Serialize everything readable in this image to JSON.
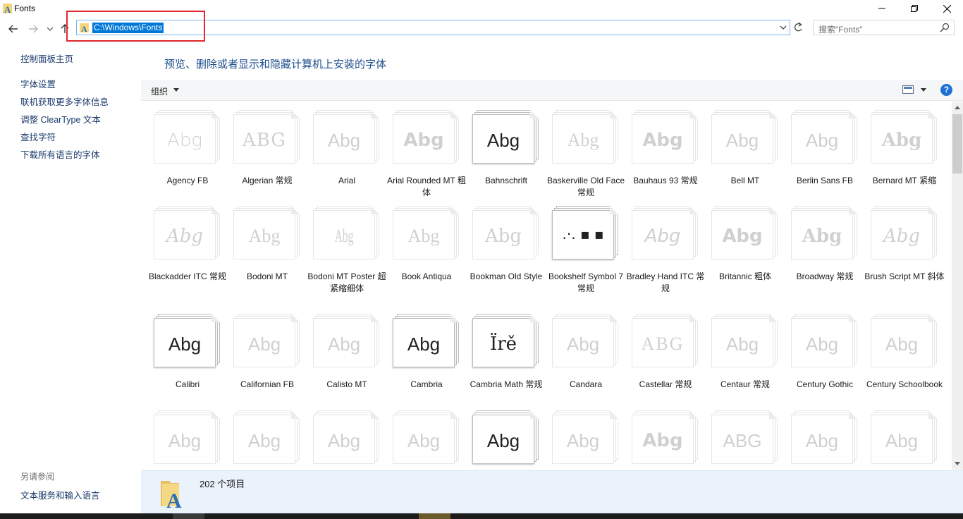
{
  "window": {
    "title": "Fonts"
  },
  "address": {
    "path": "C:\\Windows\\Fonts"
  },
  "search": {
    "placeholder": "搜索\"Fonts\""
  },
  "left_pane": {
    "home": "控制面板主页",
    "links": [
      "字体设置",
      "联机获取更多字体信息",
      "调整 ClearType 文本",
      "查找字符",
      "下载所有语言的字体"
    ],
    "see_also_title": "另请参阅",
    "see_also": [
      "文本服务和输入语言"
    ]
  },
  "heading": "预览、删除或者显示和隐藏计算机上安装的字体",
  "toolbar": {
    "organize": "组织",
    "help": "?"
  },
  "fonts": [
    {
      "name": "Agency FB",
      "sample": "Abg",
      "selected": false
    },
    {
      "name": "Algerian 常规",
      "sample": "ABG",
      "selected": false
    },
    {
      "name": "Arial",
      "sample": "Abg",
      "selected": false
    },
    {
      "name": "Arial Rounded MT 粗体",
      "sample": "Abg",
      "selected": false
    },
    {
      "name": "Bahnschrift",
      "sample": "Abg",
      "selected": true
    },
    {
      "name": "Baskerville Old Face 常规",
      "sample": "Abg",
      "selected": false
    },
    {
      "name": "Bauhaus 93 常规",
      "sample": "Abg",
      "selected": false
    },
    {
      "name": "Bell MT",
      "sample": "Abg",
      "selected": false
    },
    {
      "name": "Berlin Sans FB",
      "sample": "Abg",
      "selected": false
    },
    {
      "name": "Bernard MT 紧缩",
      "sample": "Abg",
      "selected": false
    },
    {
      "name": "Blackadder ITC 常规",
      "sample": "Abg",
      "selected": false
    },
    {
      "name": "Bodoni MT",
      "sample": "Abg",
      "selected": false
    },
    {
      "name": "Bodoni MT Poster 超紧缩细体",
      "sample": "Abg",
      "selected": false
    },
    {
      "name": "Book Antiqua",
      "sample": "Abg",
      "selected": false
    },
    {
      "name": "Bookman Old Style",
      "sample": "Abg",
      "selected": false
    },
    {
      "name": "Bookshelf Symbol 7 常规",
      "sample": ".·. ▪ ▪",
      "selected": true
    },
    {
      "name": "Bradley Hand ITC 常规",
      "sample": "Abg",
      "selected": false
    },
    {
      "name": "Britannic 粗体",
      "sample": "Abg",
      "selected": false
    },
    {
      "name": "Broadway 常规",
      "sample": "Abg",
      "selected": false
    },
    {
      "name": "Brush Script MT 斜体",
      "sample": "Abg",
      "selected": false
    },
    {
      "name": "Calibri",
      "sample": "Abg",
      "selected": true
    },
    {
      "name": "Californian FB",
      "sample": "Abg",
      "selected": false
    },
    {
      "name": "Calisto MT",
      "sample": "Abg",
      "selected": false
    },
    {
      "name": "Cambria",
      "sample": "Abg",
      "selected": true
    },
    {
      "name": "Cambria Math 常规",
      "sample": "Ïrě",
      "selected": true
    },
    {
      "name": "Candara",
      "sample": "Abg",
      "selected": false
    },
    {
      "name": "Castellar 常规",
      "sample": "ABG",
      "selected": false
    },
    {
      "name": "Centaur 常规",
      "sample": "Abg",
      "selected": false
    },
    {
      "name": "Century Gothic",
      "sample": "Abg",
      "selected": false
    },
    {
      "name": "Century Schoolbook",
      "sample": "Abg",
      "selected": false
    },
    {
      "name": "",
      "sample": "Abg",
      "selected": false
    },
    {
      "name": "",
      "sample": "Abg",
      "selected": false
    },
    {
      "name": "",
      "sample": "Abg",
      "selected": false
    },
    {
      "name": "",
      "sample": "Abg",
      "selected": false
    },
    {
      "name": "",
      "sample": "Abg",
      "selected": true
    },
    {
      "name": "",
      "sample": "Abg",
      "selected": false
    },
    {
      "name": "",
      "sample": "Abg",
      "selected": false
    },
    {
      "name": "",
      "sample": "ABG",
      "selected": false
    },
    {
      "name": "",
      "sample": "Abg",
      "selected": false
    },
    {
      "name": "",
      "sample": "Abg",
      "selected": false
    }
  ],
  "status": {
    "count": "202 个项目"
  },
  "colors": {
    "accent": "#0078d7",
    "link": "#1a3a6b",
    "heading": "#1e4e8c",
    "highlight_box": "#e0282e"
  }
}
